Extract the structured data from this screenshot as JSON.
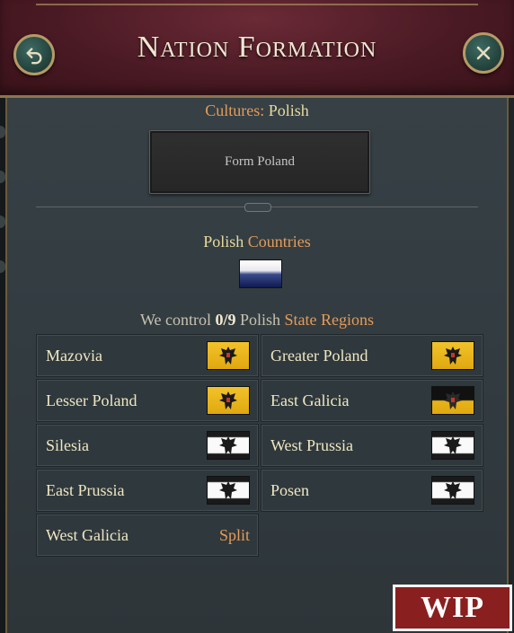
{
  "header": {
    "title": "Nation Formation",
    "back_icon": "back-arrow-icon",
    "close_icon": "close-icon"
  },
  "cultures": {
    "label": "Cultures:",
    "value": "Polish"
  },
  "form_button": {
    "label": "Form Poland"
  },
  "countries": {
    "culture": "Polish",
    "label": "Countries"
  },
  "control": {
    "prefix": "We control",
    "count": "0/9",
    "culture": "Polish",
    "link": "State Regions"
  },
  "regions": [
    {
      "name": "Mazovia",
      "flag": "gold-eagle-flag"
    },
    {
      "name": "Greater Poland",
      "flag": "gold-eagle-flag"
    },
    {
      "name": "Lesser Poland",
      "flag": "gold-eagle-flag"
    },
    {
      "name": "East Galicia",
      "flag": "black-gold-eagle-flag"
    },
    {
      "name": "Silesia",
      "flag": "prussia-flag"
    },
    {
      "name": "West Prussia",
      "flag": "prussia-flag"
    },
    {
      "name": "East Prussia",
      "flag": "prussia-flag"
    },
    {
      "name": "Posen",
      "flag": "prussia-flag"
    },
    {
      "name": "West Galicia",
      "status": "Split"
    }
  ],
  "badge": {
    "label": "WIP"
  },
  "colors": {
    "accent": "#e59b58",
    "title": "#f1e7d2",
    "header_bg": "#4a1a24",
    "panel_bg": "#363f44"
  }
}
